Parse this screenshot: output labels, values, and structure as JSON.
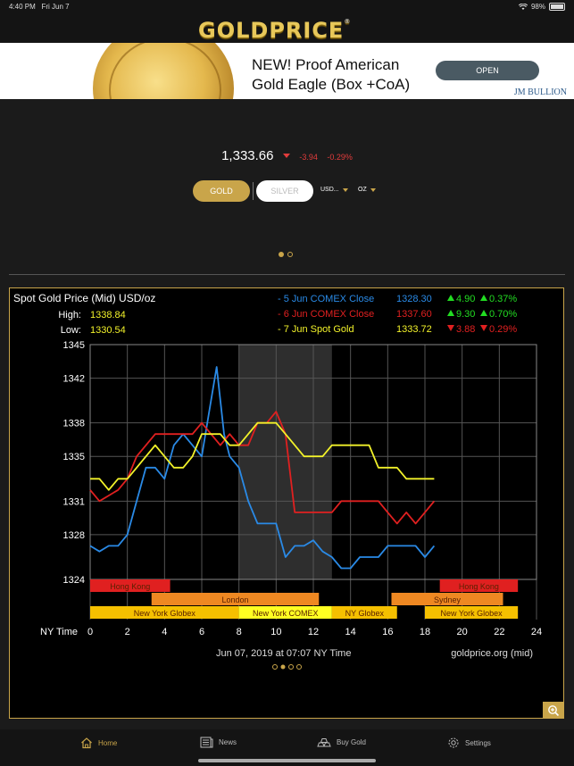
{
  "status_bar": {
    "time": "4:40 PM",
    "date": "Fri Jun 7",
    "battery": "98%",
    "icons": [
      "wifi-icon",
      "battery-icon"
    ]
  },
  "header": {
    "logo": "GOLDPRICE",
    "logo_mark": "®"
  },
  "ad": {
    "headline_1": "NEW! Proof American",
    "headline_2": "Gold Eagle (Box +CoA)",
    "cta": "OPEN",
    "brand": "JM BULLION"
  },
  "price": {
    "value": "1,333.66",
    "change": "-3.94",
    "change_pct": "-0.29%"
  },
  "controls": {
    "gold": "GOLD",
    "silver": "SILVER",
    "currency": "USD...",
    "unit": "OZ"
  },
  "chart": {
    "title": "Spot Gold Price (Mid) USD/oz",
    "high_label": "High:",
    "high": "1338.84",
    "low_label": "Low:",
    "low": "1330.54",
    "legend": [
      {
        "name": "- 5 Jun COMEX Close",
        "value": "1328.30",
        "chg": "4.90",
        "pct": "0.37%",
        "color": "#2a8ae6",
        "dir": "up"
      },
      {
        "name": "- 6 Jun COMEX Close",
        "value": "1337.60",
        "chg": "9.30",
        "pct": "0.70%",
        "color": "#e02020",
        "dir": "up"
      },
      {
        "name": "- 7 Jun Spot Gold",
        "value": "1333.72",
        "chg": "3.88",
        "pct": "0.29%",
        "color": "#f2f22a",
        "dir": "down"
      }
    ],
    "x_axis_label": "NY Time",
    "footer": "Jun 07, 2019 at 07:07 NY Time",
    "source": "goldprice.org (mid)",
    "sessions": [
      {
        "label": "Hong Kong",
        "start": 0,
        "end": 4.3,
        "row": 0,
        "color": "#e02020"
      },
      {
        "label": "Hong Kong",
        "start": 18.8,
        "end": 23,
        "row": 0,
        "color": "#e02020"
      },
      {
        "label": "London",
        "start": 3.3,
        "end": 12.3,
        "row": 1,
        "color": "#ee8822"
      },
      {
        "label": "Sydney",
        "start": 16.2,
        "end": 22.2,
        "row": 1,
        "color": "#ee8822"
      },
      {
        "label": "New York Globex",
        "start": 0,
        "end": 8,
        "row": 2,
        "color": "#f5c000"
      },
      {
        "label": "New York COMEX",
        "start": 8,
        "end": 13,
        "row": 2,
        "color": "#ffff22"
      },
      {
        "label": "NY Globex",
        "start": 13,
        "end": 16.5,
        "row": 2,
        "color": "#f5c000"
      },
      {
        "label": "New York Globex",
        "start": 18,
        "end": 23,
        "row": 2,
        "color": "#f5c000"
      }
    ]
  },
  "chart_data": {
    "type": "line",
    "ylim": [
      1324,
      1345
    ],
    "xlim": [
      0,
      24
    ],
    "y_ticks": [
      1324,
      1328,
      1331,
      1335,
      1338,
      1342,
      1345
    ],
    "x_ticks": [
      0,
      2,
      4,
      6,
      8,
      10,
      12,
      14,
      16,
      18,
      20,
      22,
      24
    ],
    "comex_shade": [
      8,
      13
    ],
    "series": [
      {
        "name": "5 Jun COMEX Close",
        "color": "#2a8ae6",
        "x": [
          0,
          0.5,
          1,
          1.5,
          2,
          2.5,
          3,
          3.5,
          4,
          4.5,
          5,
          5.5,
          6,
          6.5,
          6.8,
          7.2,
          7.5,
          8,
          8.5,
          9,
          9.5,
          10,
          10.5,
          11,
          11.5,
          12,
          12.5,
          13,
          13.5,
          14,
          14.5,
          15,
          15.5,
          16,
          16.5,
          17,
          17.5,
          18,
          18.5
        ],
        "y": [
          1327,
          1326.5,
          1327,
          1327,
          1328,
          1331,
          1334,
          1334,
          1333,
          1336,
          1337,
          1336,
          1335,
          1340,
          1343,
          1337,
          1335,
          1334,
          1331,
          1329,
          1329,
          1329,
          1326,
          1327,
          1327,
          1327.5,
          1326.5,
          1326,
          1325,
          1325,
          1326,
          1326,
          1326,
          1327,
          1327,
          1327,
          1327,
          1326,
          1327
        ]
      },
      {
        "name": "6 Jun COMEX Close",
        "color": "#e02020",
        "x": [
          0,
          0.5,
          1,
          1.5,
          2,
          2.5,
          3,
          3.5,
          4,
          4.5,
          5,
          5.5,
          6,
          6.5,
          7,
          7.5,
          8,
          8.5,
          9,
          9.5,
          10,
          10.5,
          11,
          11.5,
          12,
          12.5,
          13,
          13.5,
          14,
          14.5,
          15,
          15.5,
          16,
          16.5,
          17,
          17.5,
          18,
          18.5
        ],
        "y": [
          1332,
          1331,
          1331.5,
          1332,
          1333,
          1335,
          1336,
          1337,
          1337,
          1337,
          1337,
          1337,
          1338,
          1337,
          1336,
          1337,
          1336,
          1336,
          1338,
          1338,
          1339,
          1337,
          1330,
          1330,
          1330,
          1330,
          1330,
          1331,
          1331,
          1331,
          1331,
          1331,
          1330,
          1329,
          1330,
          1329,
          1330,
          1331
        ]
      },
      {
        "name": "7 Jun Spot Gold",
        "color": "#f2f22a",
        "x": [
          0,
          0.5,
          1,
          1.5,
          2,
          2.5,
          3,
          3.5,
          4,
          4.5,
          5,
          5.5,
          6,
          6.5,
          7,
          7.5,
          8,
          8.5,
          9,
          9.5,
          10,
          10.5,
          11,
          11.5,
          12,
          12.5,
          13,
          13.5,
          14,
          14.5,
          15,
          15.5,
          16,
          16.5,
          17,
          17.5,
          18,
          18.5
        ],
        "y": [
          1333,
          1333,
          1332,
          1333,
          1333,
          1334,
          1335,
          1336,
          1335,
          1334,
          1334,
          1335,
          1337,
          1337,
          1337,
          1336,
          1336,
          1337,
          1338,
          1338,
          1338,
          1337,
          1336,
          1335,
          1335,
          1335,
          1336,
          1336,
          1336,
          1336,
          1336,
          1334,
          1334,
          1334,
          1333,
          1333,
          1333,
          1333
        ]
      }
    ]
  },
  "tabs": [
    {
      "label": "Home",
      "icon": "home-icon"
    },
    {
      "label": "News",
      "icon": "news-icon"
    },
    {
      "label": "Buy Gold",
      "icon": "gold-bars-icon"
    },
    {
      "label": "Settings",
      "icon": "gear-icon"
    }
  ]
}
